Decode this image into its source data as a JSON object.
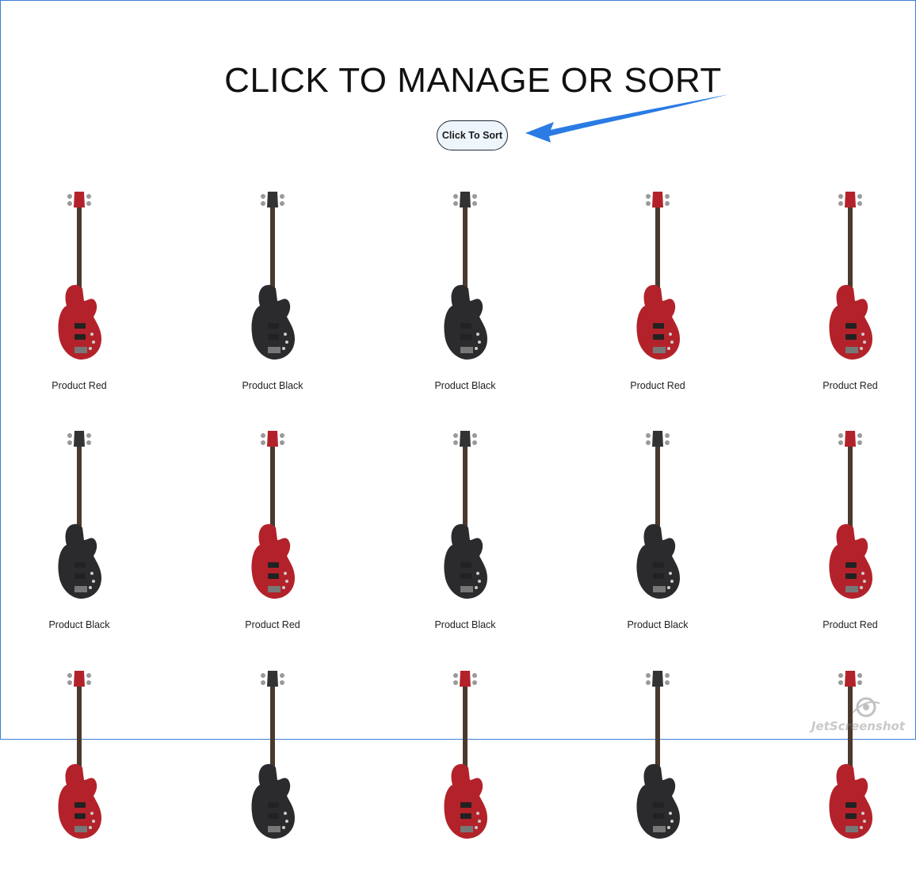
{
  "page": {
    "title": "CLICK TO MANAGE OR SORT",
    "sort_button_label": "Click To Sort"
  },
  "colors": {
    "accent_arrow": "#2a7be4",
    "frame_border": "#3d7fd6",
    "red_body": "#b3222a",
    "black_body": "#2b2b2e"
  },
  "products": [
    {
      "name": "Product Red",
      "color": "red"
    },
    {
      "name": "Product Black",
      "color": "black"
    },
    {
      "name": "Product Black",
      "color": "black"
    },
    {
      "name": "Product Red",
      "color": "red"
    },
    {
      "name": "Product Red",
      "color": "red"
    },
    {
      "name": "Product Black",
      "color": "black"
    },
    {
      "name": "Product Red",
      "color": "red"
    },
    {
      "name": "Product Black",
      "color": "black"
    },
    {
      "name": "Product Black",
      "color": "black"
    },
    {
      "name": "Product Red",
      "color": "red"
    },
    {
      "name": "",
      "color": "red"
    },
    {
      "name": "",
      "color": "black"
    },
    {
      "name": "",
      "color": "red"
    },
    {
      "name": "",
      "color": "black"
    },
    {
      "name": "",
      "color": "red"
    }
  ],
  "watermark": {
    "text": "JetScreenshot",
    "icon": "jetscreenshot-logo-icon"
  }
}
